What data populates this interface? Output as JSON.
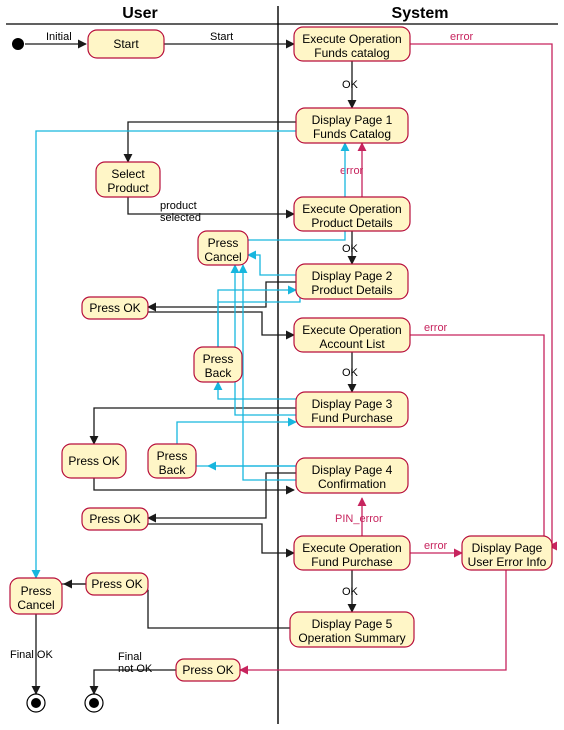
{
  "swimlanes": {
    "user": "User",
    "system": "System"
  },
  "initial": "Initial",
  "nodes": {
    "start": "Start",
    "exec_catalog_l1": "Execute Operation",
    "exec_catalog_l2": "Funds catalog",
    "disp_p1_l1": "Display Page 1",
    "disp_p1_l2": "Funds Catalog",
    "select_product_l1": "Select",
    "select_product_l2": "Product",
    "exec_details_l1": "Execute Operation",
    "exec_details_l2": "Product Details",
    "press_cancel": "Press\nCancel",
    "disp_p2_l1": "Display Page 2",
    "disp_p2_l2": "Product Details",
    "press_ok_1": "Press OK",
    "exec_acct_l1": "Execute Operation",
    "exec_acct_l2": "Account List",
    "press_back_1": "Press\nBack",
    "disp_p3_l1": "Display Page 3",
    "disp_p3_l2": "Fund Purchase",
    "press_ok_2": "Press OK",
    "press_back_2": "Press\nBack",
    "disp_p4_l1": "Display Page 4",
    "disp_p4_l2": "Confirmation",
    "press_ok_3": "Press OK",
    "exec_purchase_l1": "Execute Operation",
    "exec_purchase_l2": "Fund Purchase",
    "press_ok_4": "Press OK",
    "disp_p5_l1": "Display Page 5",
    "disp_p5_l2": "Operation Summary",
    "press_cancel_2": "Press\nCancel",
    "press_ok_final": "Press OK",
    "disp_err_l1": "Display Page",
    "disp_err_l2": "User Error Info"
  },
  "edges": {
    "start": "Start",
    "ok": "OK",
    "error": "error",
    "product_selected": "product\nselected",
    "pin_error": "PIN_error",
    "final_ok": "Final OK",
    "final_not_ok": "Final\nnot OK"
  },
  "chart_data": {
    "type": "diagram",
    "diagram_type": "uml_activity_diagram_swimlanes",
    "title": "Fund purchase flow — User / System swimlanes",
    "swimlanes": [
      "User",
      "System"
    ],
    "initial_node": "Initial",
    "final_nodes": [
      "Final_OK",
      "Final_NotOK"
    ],
    "activities": [
      {
        "id": "Start",
        "lane": "User",
        "label": "Start"
      },
      {
        "id": "ExecOp_FundsCatalog",
        "lane": "System",
        "label": "Execute Operation Funds catalog"
      },
      {
        "id": "DisplayPage1",
        "lane": "System",
        "label": "Display Page 1 Funds Catalog"
      },
      {
        "id": "SelectProduct",
        "lane": "User",
        "label": "Select Product"
      },
      {
        "id": "ExecOp_ProductDetails",
        "lane": "System",
        "label": "Execute Operation Product Details"
      },
      {
        "id": "PressCancel_1",
        "lane": "User",
        "label": "Press Cancel"
      },
      {
        "id": "DisplayPage2",
        "lane": "System",
        "label": "Display Page 2 Product Details"
      },
      {
        "id": "PressOK_1",
        "lane": "User",
        "label": "Press OK"
      },
      {
        "id": "ExecOp_AccountList",
        "lane": "System",
        "label": "Execute Operation Account List"
      },
      {
        "id": "PressBack_1",
        "lane": "User",
        "label": "Press Back"
      },
      {
        "id": "DisplayPage3",
        "lane": "System",
        "label": "Display Page 3 Fund Purchase"
      },
      {
        "id": "PressOK_2",
        "lane": "User",
        "label": "Press OK"
      },
      {
        "id": "PressBack_2",
        "lane": "User",
        "label": "Press Back"
      },
      {
        "id": "DisplayPage4",
        "lane": "System",
        "label": "Display Page 4 Confirmation"
      },
      {
        "id": "PressOK_3",
        "lane": "User",
        "label": "Press OK"
      },
      {
        "id": "ExecOp_FundPurchase",
        "lane": "System",
        "label": "Execute Operation Fund Purchase"
      },
      {
        "id": "PressOK_4",
        "lane": "User",
        "label": "Press OK"
      },
      {
        "id": "DisplayPage5",
        "lane": "System",
        "label": "Display Page 5 Operation Summary"
      },
      {
        "id": "PressCancel_2",
        "lane": "User",
        "label": "Press Cancel"
      },
      {
        "id": "DisplayUserErrorInfo",
        "lane": "System",
        "label": "Display Page User Error Info"
      },
      {
        "id": "PressOK_err",
        "lane": "User",
        "label": "Press OK"
      }
    ],
    "edges": [
      {
        "from": "Initial",
        "to": "Start",
        "label": "Initial",
        "style": "black"
      },
      {
        "from": "Start",
        "to": "ExecOp_FundsCatalog",
        "label": "Start",
        "style": "black"
      },
      {
        "from": "ExecOp_FundsCatalog",
        "to": "DisplayPage1",
        "label": "OK",
        "style": "black"
      },
      {
        "from": "ExecOp_FundsCatalog",
        "to": "DisplayUserErrorInfo",
        "label": "error",
        "style": "pink"
      },
      {
        "from": "DisplayPage1",
        "to": "SelectProduct",
        "label": "",
        "style": "black"
      },
      {
        "from": "SelectProduct",
        "to": "ExecOp_ProductDetails",
        "label": "product selected",
        "style": "black"
      },
      {
        "from": "ExecOp_ProductDetails",
        "to": "DisplayPage2",
        "label": "OK",
        "style": "black"
      },
      {
        "from": "ExecOp_ProductDetails",
        "to": "DisplayPage1",
        "label": "error",
        "style": "pink"
      },
      {
        "from": "DisplayPage1",
        "to": "PressCancel_2",
        "label": "",
        "style": "cyan"
      },
      {
        "from": "DisplayPage2",
        "to": "PressOK_1",
        "label": "",
        "style": "black"
      },
      {
        "from": "DisplayPage2",
        "to": "PressCancel_1",
        "label": "",
        "style": "cyan"
      },
      {
        "from": "PressOK_1",
        "to": "ExecOp_AccountList",
        "label": "",
        "style": "black"
      },
      {
        "from": "ExecOp_AccountList",
        "to": "DisplayPage3",
        "label": "OK",
        "style": "black"
      },
      {
        "from": "ExecOp_AccountList",
        "to": "DisplayUserErrorInfo",
        "label": "error",
        "style": "pink"
      },
      {
        "from": "PressCancel_1",
        "to": "DisplayPage1",
        "label": "",
        "style": "cyan"
      },
      {
        "from": "DisplayPage3",
        "to": "PressOK_2",
        "label": "",
        "style": "black"
      },
      {
        "from": "DisplayPage3",
        "to": "PressBack_1",
        "label": "",
        "style": "cyan"
      },
      {
        "from": "DisplayPage3",
        "to": "PressCancel_1",
        "label": "",
        "style": "cyan"
      },
      {
        "from": "PressBack_1",
        "to": "DisplayPage2",
        "label": "",
        "style": "cyan"
      },
      {
        "from": "PressOK_2",
        "to": "DisplayPage4",
        "label": "",
        "style": "black"
      },
      {
        "from": "DisplayPage4",
        "to": "PressOK_3",
        "label": "",
        "style": "black"
      },
      {
        "from": "DisplayPage4",
        "to": "PressBack_2",
        "label": "",
        "style": "cyan"
      },
      {
        "from": "DisplayPage4",
        "to": "PressCancel_1",
        "label": "",
        "style": "cyan"
      },
      {
        "from": "PressBack_2",
        "to": "DisplayPage3",
        "label": "",
        "style": "cyan"
      },
      {
        "from": "PressOK_3",
        "to": "ExecOp_FundPurchase",
        "label": "",
        "style": "black"
      },
      {
        "from": "ExecOp_FundPurchase",
        "to": "DisplayPage5",
        "label": "OK",
        "style": "black"
      },
      {
        "from": "ExecOp_FundPurchase",
        "to": "DisplayPage4",
        "label": "PIN_error",
        "style": "pink"
      },
      {
        "from": "ExecOp_FundPurchase",
        "to": "DisplayUserErrorInfo",
        "label": "error",
        "style": "pink"
      },
      {
        "from": "DisplayPage5",
        "to": "PressOK_4",
        "label": "",
        "style": "black"
      },
      {
        "from": "PressOK_4",
        "to": "PressCancel_2",
        "label": "",
        "style": "black"
      },
      {
        "from": "PressCancel_2",
        "to": "Final_OK",
        "label": "Final OK",
        "style": "black"
      },
      {
        "from": "DisplayUserErrorInfo",
        "to": "PressOK_err",
        "label": "",
        "style": "pink"
      },
      {
        "from": "PressOK_err",
        "to": "Final_NotOK",
        "label": "Final not OK",
        "style": "black"
      }
    ]
  }
}
